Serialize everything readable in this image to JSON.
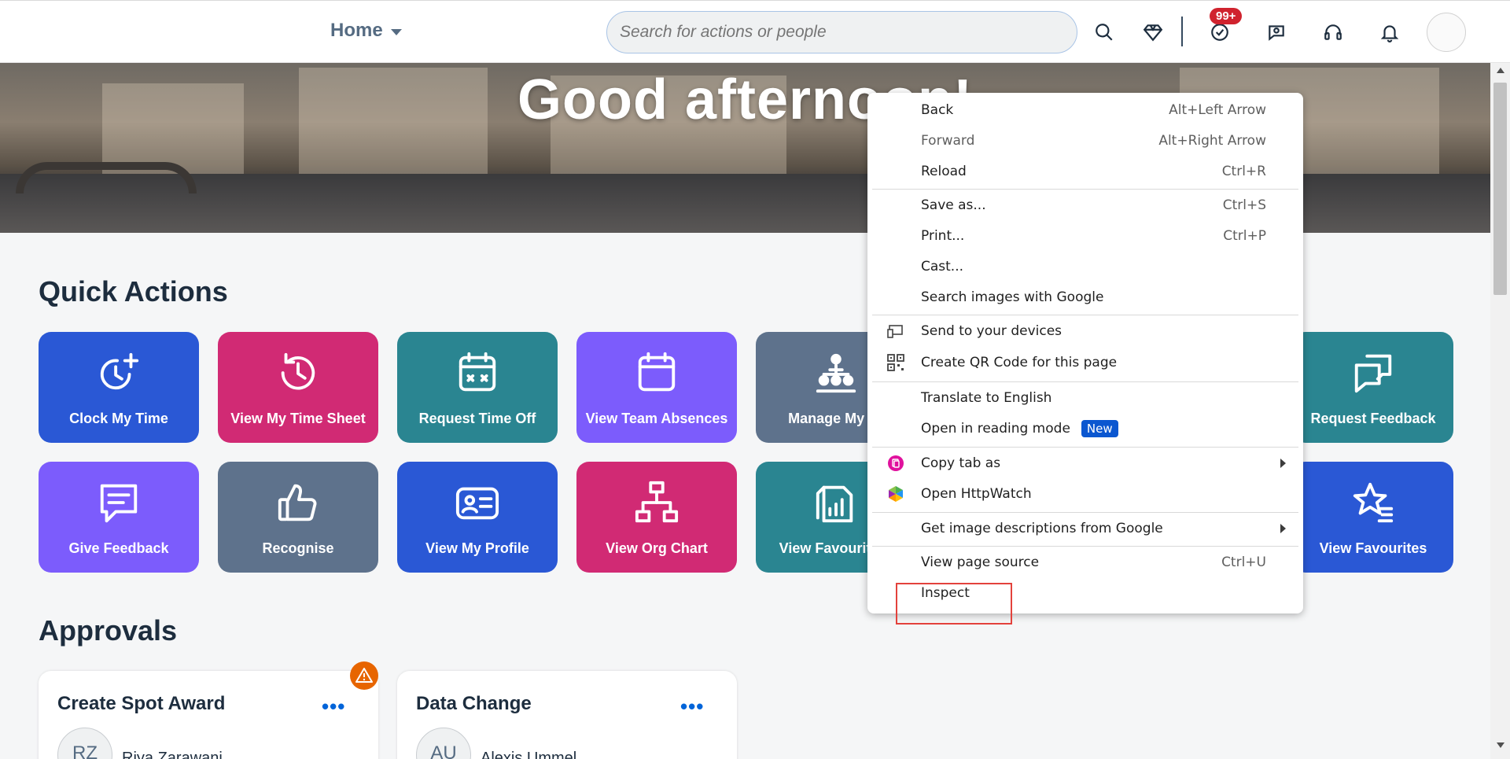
{
  "header": {
    "home_label": "Home",
    "search_placeholder": "Search for actions or people",
    "notification_badge": "99+"
  },
  "hero": {
    "greeting": "Good afternoon!"
  },
  "quick_actions": {
    "title": "Quick Actions",
    "tiles": [
      {
        "label": "Clock My Time",
        "color": "#2a58d5",
        "icon": "clock-add-icon"
      },
      {
        "label": "View My Time Sheet",
        "color": "#d12a74",
        "icon": "history-icon"
      },
      {
        "label": "Request Time Off",
        "color": "#2a8591",
        "icon": "calendar-cancel-icon"
      },
      {
        "label": "View Team Absences",
        "color": "#7c5cfc",
        "icon": "calendar-icon"
      },
      {
        "label": "Manage My Te",
        "color": "#5e728c",
        "icon": "team-hierarchy-icon"
      },
      {
        "label": "Request Feedback",
        "color": "#2a8591",
        "icon": "feedback-request-icon"
      },
      {
        "label": "Give Feedback",
        "color": "#7c5cfc",
        "icon": "give-feedback-icon"
      },
      {
        "label": "Recognise",
        "color": "#5e728c",
        "icon": "thumbs-up-icon"
      },
      {
        "label": "View My Profile",
        "color": "#2a58d5",
        "icon": "profile-card-icon"
      },
      {
        "label": "View Org Chart",
        "color": "#d12a74",
        "icon": "org-chart-icon"
      },
      {
        "label": "View Favourite R",
        "color": "#2a8591",
        "icon": "report-chart-icon"
      },
      {
        "label": "View Favourites",
        "color": "#2a58d5",
        "icon": "star-list-icon"
      }
    ]
  },
  "approvals": {
    "title": "Approvals",
    "cards": [
      {
        "title": "Create Spot Award",
        "initials": "RZ",
        "name": "Riya Zarawani"
      },
      {
        "title": "Data Change",
        "initials": "AU",
        "name": "Alexis Ummel"
      }
    ],
    "more_label": "•••"
  },
  "context_menu": {
    "items": [
      {
        "label": "Back",
        "shortcut": "Alt+Left Arrow"
      },
      {
        "label": "Forward",
        "shortcut": "Alt+Right Arrow"
      },
      {
        "label": "Reload",
        "shortcut": "Ctrl+R"
      },
      {
        "label": "Save as...",
        "shortcut": "Ctrl+S"
      },
      {
        "label": "Print...",
        "shortcut": "Ctrl+P"
      },
      {
        "label": "Cast...",
        "shortcut": ""
      },
      {
        "label": "Search images with Google",
        "shortcut": ""
      },
      {
        "label": "Send to your devices",
        "shortcut": ""
      },
      {
        "label": "Create QR Code for this page",
        "shortcut": ""
      },
      {
        "label": "Translate to English",
        "shortcut": ""
      },
      {
        "label": "Open in reading mode",
        "shortcut": "",
        "badge": "New"
      },
      {
        "label": "Copy tab as",
        "shortcut": ""
      },
      {
        "label": "Open HttpWatch",
        "shortcut": ""
      },
      {
        "label": "Get image descriptions from Google",
        "shortcut": ""
      },
      {
        "label": "View page source",
        "shortcut": "Ctrl+U"
      },
      {
        "label": "Inspect",
        "shortcut": ""
      }
    ]
  }
}
